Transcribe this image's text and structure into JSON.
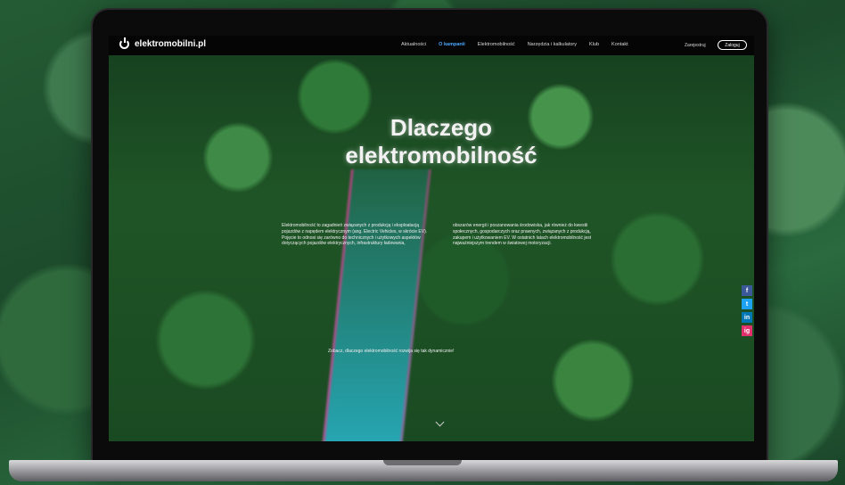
{
  "header": {
    "logo_text": "elektromobilni.pl",
    "nav": [
      "Aktualności",
      "O kampanii",
      "Elektromobilność",
      "Narzędzia i kalkulatory",
      "Klub",
      "Kontakt"
    ],
    "active_nav": "O kampanii",
    "register_label": "Zarejestruj",
    "login_label": "Zaloguj"
  },
  "hero": {
    "title_line1": "Dlaczego",
    "title_line2": "elektromobilność",
    "paragraph_left": "Elektromobilność to zagadnień związanych z produkcją i eksploatacją pojazdów z napędem elektrycznym (ang. Electric Vehicles, w skrócie EV). Pojęcie to odnosi się zarówno do technicznych i użytkowych aspektów dotyczących pojazdów elektrycznych, infrastruktury ładowania,",
    "paragraph_right": "obszarów energii i poszanowania środowiska, jak również do kwestii społecznych, gospodarczych oraz prawnych, związanych z produkcją, zakupem i użytkowaniem EV. W ostatnich latach elektromobilność jest najważniejszym trendem w światowej motoryzacji.",
    "tagline": "Zobacz, dlaczego elektromobilność rozwija się tak dynamicznie!"
  },
  "social": {
    "facebook": "f",
    "twitter": "t",
    "linkedin": "in",
    "instagram": "ig"
  },
  "colors": {
    "accent": "#4aa8ff",
    "facebook": "#3b5998",
    "twitter": "#1da1f2",
    "linkedin": "#0077b5",
    "instagram": "#e1306c"
  }
}
